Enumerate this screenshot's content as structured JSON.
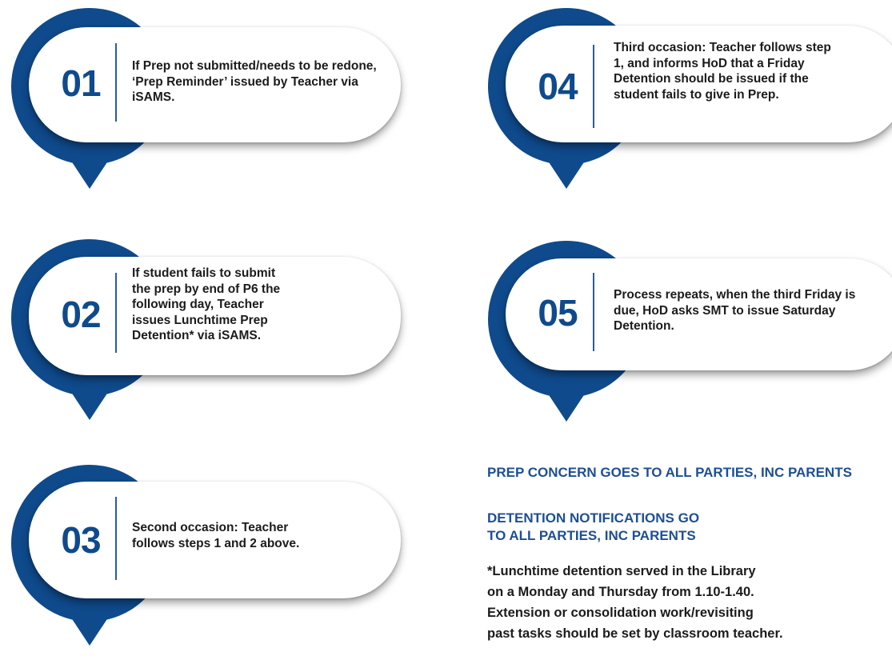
{
  "colors": {
    "primary": "#0f4a8c",
    "shadow": "#8f8f8f",
    "divider": "#2a5c9b",
    "text": "#1b1b1b"
  },
  "steps": [
    {
      "number": "01",
      "text": "If Prep not submitted/needs to be redone, ‘Prep Reminder’ issued by Teacher via iSAMS."
    },
    {
      "number": "02",
      "text": "If student fails to submit the prep by end of P6 the following day, Teacher issues Lunchtime Prep Detention* via iSAMS."
    },
    {
      "number": "03",
      "text": "Second occasion: Teacher follows steps 1 and 2 above."
    },
    {
      "number": "04",
      "text": "Third occasion: Teacher follows step 1, and informs HoD that a Friday Detention should be issued if the student fails to give in Prep."
    },
    {
      "number": "05",
      "text": "Process repeats, when the third Friday is due, HoD asks SMT to issue Saturday Detention."
    }
  ],
  "notices": {
    "prep_concern": "PREP CONCERN GOES TO ALL PARTIES, INC PARENTS",
    "detention_notifications": "DETENTION NOTIFICATIONS GO\nTO ALL PARTIES, INC PARENTS",
    "footnote": "*Lunchtime detention served in the Library\non a Monday and Thursday from 1.10-1.40.\nExtension or consolidation work/revisiting\npast tasks should be set by classroom teacher."
  }
}
